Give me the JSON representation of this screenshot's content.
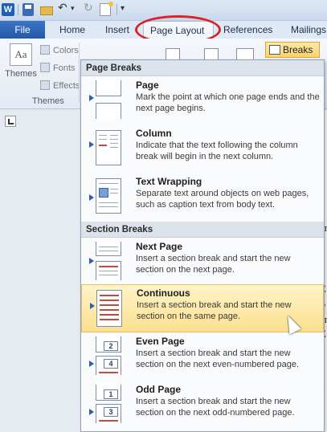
{
  "quick_access": {
    "app_icon_letter": "W",
    "icons": [
      "word-icon",
      "save-icon",
      "open-folder-icon",
      "undo-icon",
      "redo-icon",
      "new-document-icon",
      "customize-icon"
    ]
  },
  "tabs": {
    "file": "File",
    "home": "Home",
    "insert": "Insert",
    "page_layout": "Page Layout",
    "references": "References",
    "mailings": "Mailings"
  },
  "ribbon": {
    "themes_label": "Themes",
    "themes_thumb": "Aa",
    "colors_label": "Colors",
    "fonts_label": "Fonts",
    "effects_label": "Effects",
    "group_label": "Themes",
    "breaks_label": "Breaks"
  },
  "breaks_menu": {
    "page_breaks_header": "Page Breaks",
    "section_breaks_header": "Section Breaks",
    "items": [
      {
        "title": "Page",
        "description": "Mark the point at which one page ends and the next page begins."
      },
      {
        "title": "Column",
        "description": "Indicate that the text following the column break will begin in the next column."
      },
      {
        "title": "Text Wrapping",
        "description": "Separate text around objects on web pages, such as caption text from body text."
      },
      {
        "title": "Next Page",
        "description": "Insert a section break and start the new section on the next page."
      },
      {
        "title": "Continuous",
        "description": "Insert a section break and start the new section on the same page."
      },
      {
        "title": "Even Page",
        "description": "Insert a section break and start the new section on the next even-numbered page."
      },
      {
        "title": "Odd Page",
        "description": "Insert a section break and start the new section on the next odd-numbered page."
      }
    ],
    "highlighted_item": "Continuous",
    "even_page_numbers": [
      "2",
      "4"
    ],
    "odd_page_numbers": [
      "1",
      "3"
    ]
  },
  "document_fragments": [
    "er",
    "p",
    "E",
    "P",
    "er",
    "E",
    "d",
    "p"
  ],
  "colors": {
    "file_tab": "#2459a8",
    "highlight": "#fbe08f",
    "annotation_oval": "#d9232b"
  }
}
